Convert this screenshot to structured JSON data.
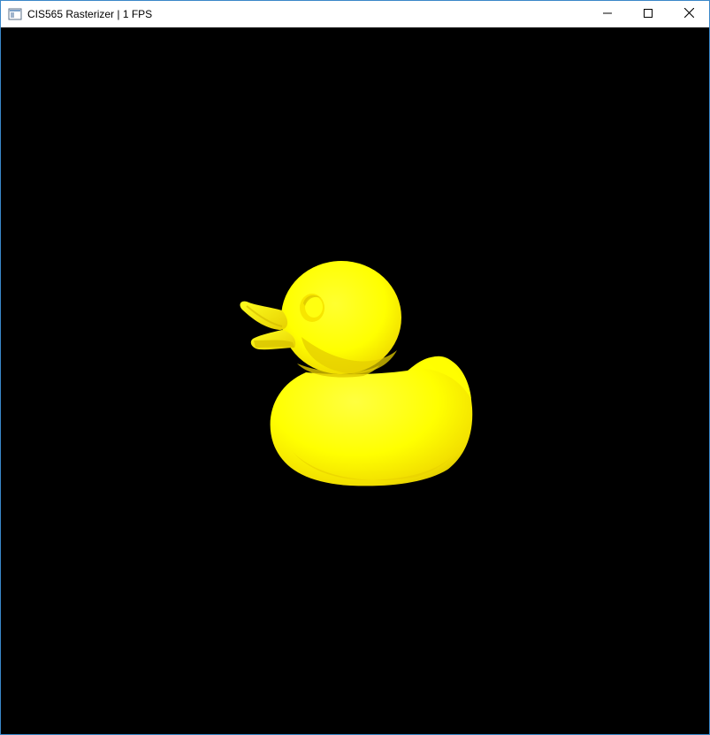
{
  "window": {
    "title": "CIS565 Rasterizer | 1 FPS",
    "border_color": "#3a87c9"
  },
  "titlebar": {
    "icon": "app-window-icon",
    "buttons": [
      {
        "name": "minimize-button",
        "icon": "minimize-icon"
      },
      {
        "name": "maximize-button",
        "icon": "maximize-icon"
      },
      {
        "name": "close-button",
        "icon": "close-icon"
      }
    ]
  },
  "viewport": {
    "background": "#000000",
    "model": "rubber-duck",
    "model_color": "#ffff00"
  }
}
